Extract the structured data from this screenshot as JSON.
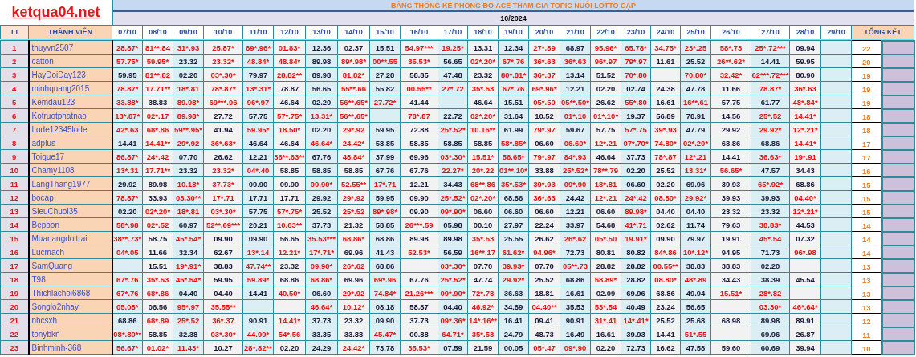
{
  "logo": "ketqua04.net",
  "title": "BẢNG THỐNG KÊ PHONG ĐỘ ACE THAM GIA TOPIC NUÔI LOTTO CẶP",
  "month": "10/2024",
  "columns": {
    "number": "TT",
    "member": "THÀNH VIÊN",
    "dates": [
      "07/10",
      "08/10",
      "09/10",
      "10/10",
      "11/10",
      "12/10",
      "13/10",
      "14/10",
      "15/10",
      "16/10",
      "17/10",
      "18/10",
      "19/10",
      "20/10",
      "21/10",
      "22/10",
      "23/10",
      "24/10",
      "25/10",
      "26/10",
      "27/10",
      "28/10",
      "29/10"
    ],
    "total": "TỔNG KẾT"
  },
  "rows": [
    {
      "no": "1",
      "name": "thuyvn2507",
      "total": "22",
      "cells": [
        "28.87*",
        "81**.84",
        "31*.93",
        "25.87*",
        "69*.96*",
        "01.83*",
        "12.36",
        "02.37",
        "15.51",
        "54.97***",
        "19.25*",
        "13.31",
        "12.34",
        "27*.89",
        "68.97",
        "95.96*",
        "65.78*",
        "34.75*",
        "23*.25",
        "58*.73",
        "25*.72***",
        "09.94"
      ],
      "hits": [
        true,
        true,
        true,
        true,
        true,
        true,
        false,
        false,
        false,
        true,
        true,
        false,
        false,
        true,
        false,
        true,
        true,
        true,
        true,
        true,
        true,
        false
      ]
    },
    {
      "no": "2",
      "name": "catton",
      "total": "20",
      "cells": [
        "57.75*",
        "59.95*",
        "23.32",
        "23.32*",
        "48.84*",
        "48.84*",
        "89.98",
        "89*.98*",
        "00**.55",
        "35.53*",
        "56.65",
        "02*.20*",
        "67*.76",
        "36*.63",
        "36*.63",
        "96*.97",
        "79*.97",
        "11.61",
        "25.52",
        "26**.62*",
        "14.41",
        "59.95"
      ],
      "hits": [
        true,
        true,
        false,
        true,
        true,
        true,
        false,
        true,
        true,
        true,
        false,
        true,
        true,
        true,
        true,
        true,
        true,
        false,
        false,
        true,
        false,
        false
      ]
    },
    {
      "no": "3",
      "name": "HayDoiDay123",
      "total": "19",
      "cells": [
        "59.95",
        "81**.82",
        "02.20",
        "03*.30*",
        "79.97",
        "28.82**",
        "89.98",
        "81.82*",
        "27.28",
        "58.85",
        "47.48",
        "23.32",
        "80*.81*",
        "36*.37",
        "13.14",
        "51.52",
        "70*.80",
        null,
        "70.80*",
        "32.42*",
        "62***.72***",
        "80.90"
      ],
      "hits": [
        false,
        true,
        false,
        true,
        false,
        true,
        false,
        true,
        false,
        false,
        false,
        false,
        true,
        true,
        false,
        false,
        true,
        false,
        true,
        true,
        true,
        false
      ]
    },
    {
      "no": "4",
      "name": "minhquang2015",
      "total": "19",
      "cells": [
        "78.87*",
        "17.71**",
        "18*.81",
        "78*.87*",
        "13*.31*",
        "78.87",
        "56.65",
        "55**.66",
        "55.82",
        "00.55**",
        "27*.72",
        "35*.53",
        "67*.76",
        "69*.96*",
        "12.21",
        "02.20",
        "02.74",
        "24.38",
        "47.78",
        "11.66",
        "78.87*",
        "36*.63"
      ],
      "hits": [
        true,
        true,
        true,
        true,
        true,
        false,
        false,
        true,
        false,
        true,
        true,
        true,
        true,
        true,
        false,
        false,
        false,
        false,
        false,
        false,
        true,
        true
      ]
    },
    {
      "no": "5",
      "name": "Kemdau123",
      "total": "19",
      "cells": [
        "33.88*",
        "38.83",
        "89.98*",
        "69***.96",
        "96*.97",
        "46.64",
        "02.20",
        "56**.65*",
        "27.72*",
        "41.44",
        null,
        "46.64",
        "15.51",
        "05*.50",
        "05**.50*",
        "26.62",
        "55*.80",
        "16.61",
        "16**.61",
        "57.75",
        "61.77",
        "48*.84*"
      ],
      "hits": [
        true,
        false,
        true,
        true,
        true,
        false,
        false,
        true,
        true,
        false,
        false,
        false,
        false,
        true,
        true,
        false,
        true,
        false,
        true,
        false,
        false,
        true
      ]
    },
    {
      "no": "6",
      "name": "Kotruotphatnao",
      "total": "18",
      "cells": [
        "13*.87*",
        "02*.17",
        "89.98*",
        "27.72",
        "57.75",
        "57*.75*",
        "13.31*",
        "56**.65*",
        null,
        "78*.87",
        "22.72",
        "02*.20*",
        "31.64",
        "10.52",
        "01*.10",
        "01*.10*",
        "19.37",
        "56.89",
        "78.91",
        "14.56",
        "25*.52",
        "14.41*"
      ],
      "hits": [
        true,
        true,
        true,
        false,
        false,
        true,
        true,
        true,
        false,
        true,
        false,
        true,
        false,
        false,
        true,
        true,
        false,
        false,
        false,
        false,
        true,
        true
      ]
    },
    {
      "no": "7",
      "name": "Lode12345lode",
      "total": "18",
      "cells": [
        "42*.63",
        "68*.86",
        "59**.95*",
        "41.94",
        "59.95*",
        "18.50*",
        "02.20",
        "29*.92",
        "59.95",
        "72.88",
        "25*.52*",
        "10.16**",
        "61.99",
        "79*.97",
        "59.67",
        "57.75",
        "57*.75",
        "39*.93",
        "47.79",
        "29.92",
        "29.92*",
        "12*.21*"
      ],
      "hits": [
        true,
        true,
        true,
        false,
        true,
        true,
        false,
        true,
        false,
        false,
        true,
        true,
        false,
        true,
        false,
        false,
        true,
        true,
        false,
        false,
        true,
        true
      ]
    },
    {
      "no": "8",
      "name": "adplus",
      "total": "17",
      "cells": [
        "14.41",
        "14.41**",
        "29*.92",
        "36*.63*",
        "46.64",
        "46.64",
        "46.64*",
        "24.42*",
        "58.85",
        "58.85",
        "58.85",
        "58.85",
        "58*.85*",
        "06.60",
        "06.60*",
        "12*.21",
        "07*.70*",
        "74.80*",
        "02*.20*",
        "68.86",
        "68.86",
        "14.41*"
      ],
      "hits": [
        false,
        true,
        true,
        true,
        false,
        false,
        true,
        true,
        false,
        false,
        false,
        false,
        true,
        false,
        true,
        true,
        true,
        true,
        true,
        false,
        false,
        true
      ]
    },
    {
      "no": "9",
      "name": "Toique17",
      "total": "17",
      "cells": [
        "86.87*",
        "24*.42",
        "07.70",
        "26.62",
        "12.21",
        "36**.63**",
        "67.76",
        "48.84*",
        "37.99",
        "69.96",
        "03*.30*",
        "15.51*",
        "56.65*",
        "79*.97",
        "84*.93",
        "46.64",
        "37.73",
        "78*.87",
        "12*.21",
        "14.41",
        "36.63*",
        "19*.91"
      ],
      "hits": [
        true,
        true,
        false,
        false,
        false,
        true,
        false,
        true,
        false,
        false,
        true,
        true,
        true,
        true,
        true,
        false,
        false,
        true,
        true,
        false,
        true,
        true
      ]
    },
    {
      "no": "10",
      "name": "Chamy1108",
      "total": "16",
      "cells": [
        "13*.31",
        "17.71**",
        "23.32",
        "23.32*",
        "04*.40",
        "58.85",
        "58.85",
        "58.85",
        "67.76",
        "67.76",
        "22.27*",
        "20*.22",
        "01**.10*",
        "33.88",
        "25*.52*",
        "78**.79",
        "02.20",
        "25.52",
        "13.31*",
        "56.65*",
        "47.57",
        "34.43"
      ],
      "hits": [
        true,
        true,
        false,
        true,
        true,
        false,
        false,
        false,
        false,
        false,
        true,
        true,
        true,
        false,
        true,
        true,
        false,
        false,
        true,
        true,
        false,
        false
      ]
    },
    {
      "no": "11",
      "name": "LangThang1977",
      "total": "15",
      "cells": [
        "29.92",
        "89.98",
        "10.18*",
        "37.73*",
        "09.90",
        "09.90",
        "09.90*",
        "52.55**",
        "17*.71",
        "12.21",
        "34.43",
        "68**.86",
        "35*.53*",
        "39*.93",
        "09*.90",
        "18*.81",
        "06.60",
        "02.20",
        "69.96",
        "39.93",
        "65*.92*",
        "68.86"
      ],
      "hits": [
        false,
        false,
        true,
        true,
        false,
        false,
        true,
        true,
        true,
        false,
        false,
        true,
        true,
        true,
        true,
        true,
        false,
        false,
        false,
        false,
        true,
        false
      ]
    },
    {
      "no": "12",
      "name": "bocap",
      "total": "15",
      "cells": [
        "78.87*",
        "33.93",
        "03.30**",
        "17*.71",
        "17.71",
        "17.71",
        "29.92",
        "29*.92",
        "59.95",
        "09.90",
        "25*.52*",
        "02*.20*",
        "68.86",
        "36*.63",
        "24.42",
        "12*.21",
        "24*.42",
        "08.80*",
        "29.92*",
        "39.93",
        "39.93",
        "04.40*"
      ],
      "hits": [
        true,
        false,
        true,
        true,
        false,
        false,
        false,
        true,
        false,
        false,
        true,
        true,
        false,
        true,
        false,
        true,
        true,
        true,
        true,
        false,
        false,
        true
      ]
    },
    {
      "no": "13",
      "name": "SieuChuoi35",
      "total": "15",
      "cells": [
        "02.20",
        "02*.20*",
        "18*.81",
        "03*.30*",
        "57.75",
        "57*.75*",
        "25.52",
        "25*.52",
        "89*.98*",
        "09.90",
        "09*.90*",
        "06.60",
        "06.60",
        "06.60",
        "12.21",
        "06.60",
        "89.98*",
        "04.40",
        "04.40",
        "23.32",
        "23.32",
        "12*.21*"
      ],
      "hits": [
        false,
        true,
        true,
        true,
        false,
        true,
        false,
        true,
        true,
        false,
        true,
        false,
        false,
        false,
        false,
        false,
        true,
        false,
        false,
        false,
        false,
        true
      ]
    },
    {
      "no": "14",
      "name": "Bepbon",
      "total": "14",
      "cells": [
        "58*.98",
        "02*.52",
        "60.97",
        "52**.69***",
        "20.21",
        "10.63**",
        "37.73",
        "21.32",
        "58.85",
        "26***.59",
        "05.98",
        "00.10",
        "27.97",
        "22.24",
        "33.97",
        "54.68",
        "41*.71",
        "02.62",
        "11.74",
        "79.63",
        "38.83*",
        "44.53"
      ],
      "hits": [
        true,
        true,
        false,
        true,
        false,
        true,
        false,
        false,
        false,
        true,
        false,
        false,
        false,
        false,
        false,
        false,
        true,
        false,
        false,
        false,
        true,
        false
      ]
    },
    {
      "no": "15",
      "name": "Muanangdoitrai",
      "total": "14",
      "cells": [
        "38**.73*",
        "58.75",
        "45*.54*",
        "09.90",
        "09.90",
        "56.65",
        "35.53***",
        "68.86*",
        "68.86",
        "89.98",
        "89.98",
        "35*.53",
        "25.55",
        "26.62",
        "26*.62",
        "05*.50",
        "19.91*",
        "09.90",
        "79.97",
        "19.91",
        "45*.54",
        "07.32"
      ],
      "hits": [
        true,
        false,
        true,
        false,
        false,
        false,
        true,
        true,
        false,
        false,
        false,
        true,
        false,
        false,
        true,
        true,
        true,
        false,
        false,
        false,
        true,
        false
      ]
    },
    {
      "no": "16",
      "name": "Lucmach",
      "total": "14",
      "cells": [
        "04*.05",
        "11.66",
        "32.34",
        "62.67",
        "13*.14",
        "12.21*",
        "17*.71*",
        "69.96",
        "41.43",
        "52.53*",
        "56.59",
        "16**.17",
        "61.62*",
        "94.96*",
        "72.73",
        "80.81",
        "80.82",
        "84*.86",
        "10*.12*",
        "94.95",
        "71.73",
        "96*.98"
      ],
      "hits": [
        true,
        false,
        false,
        false,
        true,
        true,
        true,
        false,
        false,
        true,
        false,
        true,
        true,
        true,
        false,
        false,
        false,
        true,
        true,
        false,
        false,
        true
      ]
    },
    {
      "no": "17",
      "name": "SamQuang",
      "total": "13",
      "cells": [
        null,
        "15.51",
        "19*.91*",
        "38.83",
        "47.74**",
        "23.32",
        "09.90*",
        "26*.62",
        "68.86",
        null,
        "03*.30*",
        "07.70",
        "39.93*",
        "07.70",
        "05**.73",
        "28.82",
        "28.82",
        "00.55**",
        "38.83",
        "38.83",
        "02.20",
        null
      ],
      "hits": [
        false,
        false,
        true,
        false,
        true,
        false,
        true,
        true,
        false,
        false,
        true,
        false,
        true,
        false,
        true,
        false,
        false,
        true,
        false,
        false,
        false,
        false
      ]
    },
    {
      "no": "18",
      "name": "T98",
      "total": "13",
      "cells": [
        "67*.76",
        "35*.53",
        "45*.54*",
        "59.95",
        "59.89*",
        "68.86",
        "68.86*",
        "69.96",
        "69*.96",
        "67.76",
        "25*.52*",
        "47.74",
        "29.92*",
        "25.52",
        "68.86",
        "58.89*",
        "28.82",
        "08.80*",
        "48*.89",
        "34.43",
        "38.39",
        "45.54"
      ],
      "hits": [
        true,
        true,
        true,
        false,
        true,
        false,
        true,
        false,
        true,
        false,
        true,
        false,
        true,
        false,
        false,
        true,
        false,
        true,
        true,
        false,
        false,
        false
      ]
    },
    {
      "no": "19",
      "name": "Thichlachoi6868",
      "total": "13",
      "cells": [
        "67*.76",
        "68*.86",
        "04.40",
        "04.40",
        "14.41",
        "40.50*",
        "06.60",
        "29*.92",
        "74.84*",
        "21.26***",
        "09*.90*",
        "72*.78",
        "36.63",
        "18.81",
        "16.61",
        "02.09",
        "69.96",
        "68.86",
        "49.94",
        "15.51*",
        "28*.82",
        null
      ],
      "hits": [
        true,
        true,
        false,
        false,
        false,
        true,
        false,
        true,
        true,
        true,
        true,
        true,
        false,
        false,
        false,
        false,
        false,
        false,
        false,
        true,
        true,
        false
      ]
    },
    {
      "no": "20",
      "name": "Songlo2nhay",
      "total": "13",
      "cells": [
        "05.08*",
        "06.56",
        "95*.97",
        "35.55**",
        null,
        null,
        "46.64*",
        "10.12*",
        "08.18",
        "58.87",
        "04.40",
        "46.92*",
        "34.89",
        "04.40**",
        "35.53",
        "53*.54",
        "40.49",
        "23.24",
        "56.65",
        null,
        "03.30*",
        "46*.64*"
      ],
      "hits": [
        true,
        false,
        true,
        true,
        false,
        false,
        true,
        true,
        false,
        false,
        false,
        true,
        false,
        true,
        false,
        true,
        false,
        false,
        false,
        false,
        true,
        true
      ]
    },
    {
      "no": "21",
      "name": "nhcsxh",
      "total": "12",
      "cells": [
        "68.86",
        "68*.89",
        "25*.52",
        "36*.37",
        "90.91",
        "14.41*",
        "37.73",
        "23.32",
        "09.90",
        "37.73",
        "09*.36*",
        "14*.16**",
        "16.41",
        "09.41",
        "90.91",
        "31*.41",
        "14*.41*",
        "25.52",
        "25.68",
        "68.98",
        "89.98",
        "89.91"
      ],
      "hits": [
        false,
        true,
        true,
        true,
        false,
        true,
        false,
        false,
        false,
        false,
        true,
        true,
        false,
        false,
        false,
        true,
        true,
        false,
        false,
        false,
        false,
        false
      ]
    },
    {
      "no": "22",
      "name": "tonybkn",
      "total": "11",
      "cells": [
        "08*.80**",
        "58.85",
        "32.38",
        "03*.30*",
        "44.99*",
        "54*.56",
        "33.35",
        "33.88",
        "45.47*",
        "00.88",
        "64.71*",
        "35*.53",
        "24.79",
        "48.73",
        "16.49",
        "16.61",
        "39.93",
        "14.41",
        "51*.55",
        null,
        "69.96",
        "26.87"
      ],
      "hits": [
        true,
        false,
        false,
        true,
        true,
        true,
        false,
        false,
        true,
        false,
        true,
        true,
        false,
        false,
        false,
        false,
        false,
        false,
        true,
        false,
        false,
        false
      ]
    },
    {
      "no": "23",
      "name": "Binhminh-368",
      "total": "10",
      "cells": [
        "56.67*",
        "01.02*",
        "11.43*",
        "10.27",
        "28*.82**",
        "02.20",
        "24.29",
        "24.42*",
        "73.78",
        "35.53*",
        "07.59",
        "21.59",
        "00.05",
        "05*.47",
        "09*.90",
        "02.20",
        "72.73",
        "16.62",
        "47.58",
        "59.60",
        "60.69",
        "39.94"
      ],
      "hits": [
        true,
        true,
        true,
        false,
        true,
        false,
        false,
        true,
        false,
        true,
        false,
        false,
        false,
        true,
        true,
        false,
        false,
        false,
        false,
        false,
        false,
        false
      ]
    }
  ]
}
